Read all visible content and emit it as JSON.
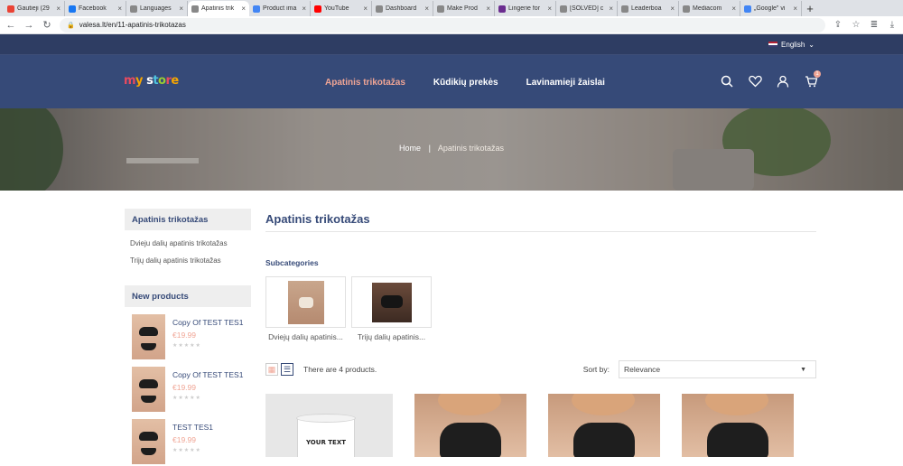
{
  "browser": {
    "tabs": [
      {
        "title": "Gautieji (29",
        "color": "#ea4335"
      },
      {
        "title": "Facebook",
        "color": "#1877f2"
      },
      {
        "title": "Languages",
        "color": "#888888"
      },
      {
        "title": "Apatinis trik",
        "color": "#888888",
        "active": true
      },
      {
        "title": "Product ima",
        "color": "#4285f4"
      },
      {
        "title": "YouTube",
        "color": "#ff0000"
      },
      {
        "title": "Dashboard",
        "color": "#888888"
      },
      {
        "title": "Make Prod",
        "color": "#888888"
      },
      {
        "title": "Lingerie for",
        "color": "#6b2d8f"
      },
      {
        "title": "[SOLVED] c",
        "color": "#888888"
      },
      {
        "title": "Leaderboa",
        "color": "#888888"
      },
      {
        "title": "Mediacom",
        "color": "#888888"
      },
      {
        "title": "„Google\" vi",
        "color": "#4285f4"
      }
    ],
    "url": "valesa.lt/en/11-apatinis-trikotazas"
  },
  "header": {
    "language": "English",
    "logo": "my store",
    "menu": [
      "Apatinis trikotažas",
      "Kūdikių prekės",
      "Lavinamieji žaislai"
    ],
    "cart_count": "1"
  },
  "breadcrumb": {
    "home": "Home",
    "separator": "|",
    "current": "Apatinis trikotažas"
  },
  "sidebar": {
    "category_title": "Apatinis trikotažas",
    "links": [
      "Dvieju dalių apatinis trikotažas",
      "Trijų dalių apatinis trikotažas"
    ],
    "new_products_title": "New products",
    "new_products": [
      {
        "name": "Copy Of TEST TES1",
        "price": "€19.99"
      },
      {
        "name": "Copy Of TEST TES1",
        "price": "€19.99"
      },
      {
        "name": "TEST TES1",
        "price": "€19.99"
      }
    ]
  },
  "main": {
    "title": "Apatinis trikotažas",
    "subcategories_label": "Subcategories",
    "subcategories": [
      "Dviejų dalių apatinis...",
      "Trijų dalių apatinis..."
    ],
    "product_count": "There are 4 products.",
    "sort_label": "Sort by:",
    "sort_value": "Relevance",
    "mug_text": "YOUR TEXT"
  },
  "colors": {
    "navy": "#364a78",
    "accent": "#f0a595"
  }
}
